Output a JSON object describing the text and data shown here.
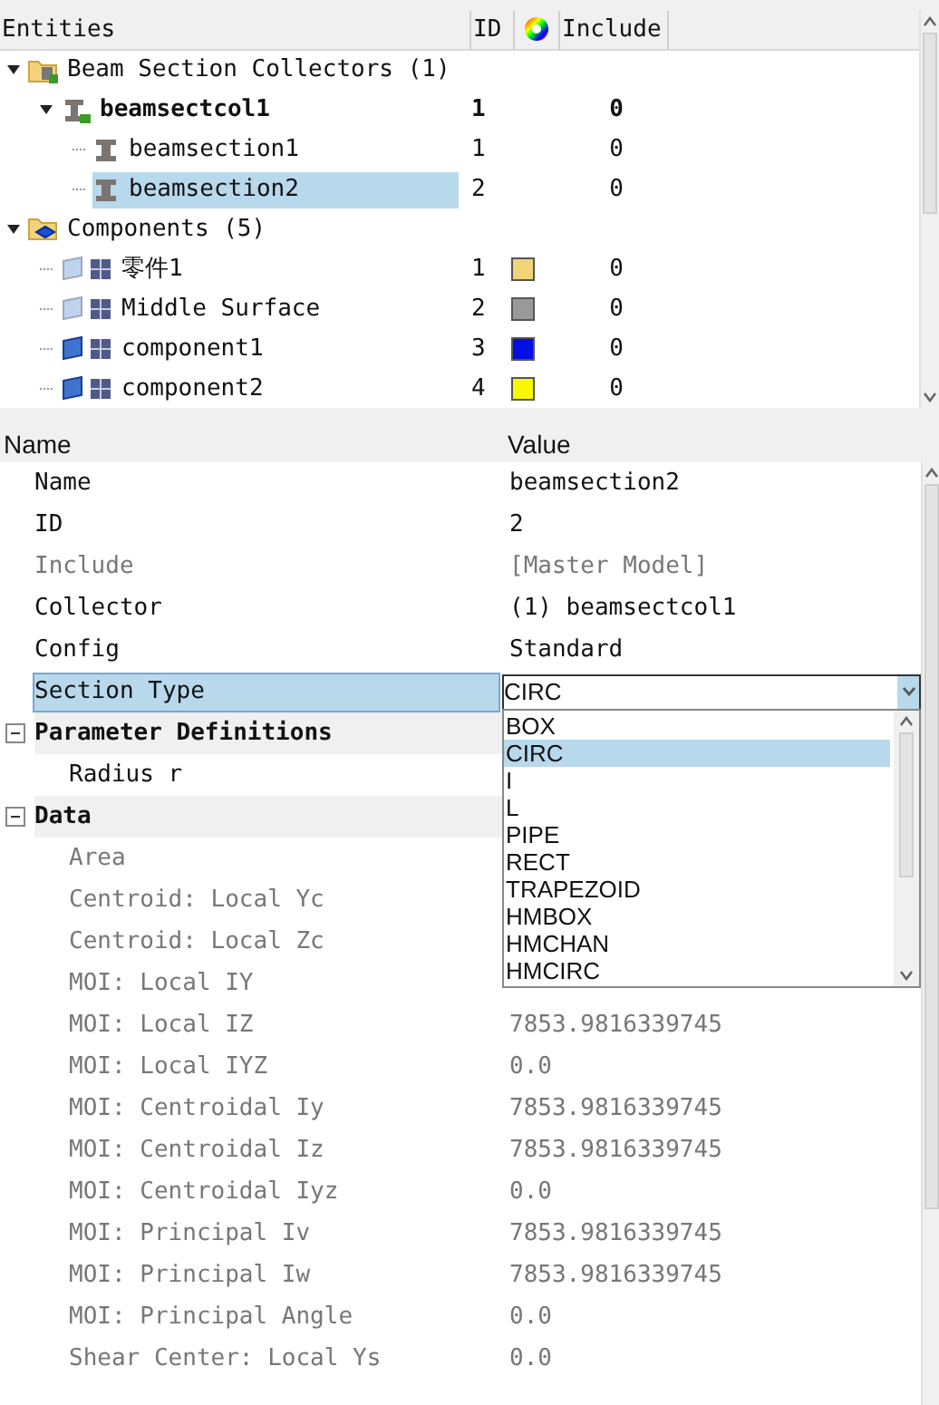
{
  "tree": {
    "columns": [
      "Entities",
      "ID",
      "Include"
    ],
    "nodes": [
      {
        "kind": "beam_folder",
        "label": "Beam Section Collectors (1)",
        "expanded": true,
        "children": [
          {
            "kind": "beam_collector",
            "label": "beamsectcol1",
            "id": "1",
            "include": "0",
            "bold": true,
            "expanded": true,
            "selected": false,
            "children": [
              {
                "kind": "beam_section",
                "label": "beamsection1",
                "id": "1",
                "include": "0",
                "selected": false
              },
              {
                "kind": "beam_section",
                "label": "beamsection2",
                "id": "2",
                "include": "0",
                "selected": true
              }
            ]
          }
        ]
      },
      {
        "kind": "component_folder",
        "label": "Components (5)",
        "expanded": true,
        "children": [
          {
            "kind": "component_hidden",
            "label": "零件1",
            "id": "1",
            "include": "0",
            "color": "#f0d478",
            "selected": false
          },
          {
            "kind": "component_hidden",
            "label": "Middle Surface",
            "id": "2",
            "include": "0",
            "color": "#9a9a9a",
            "selected": false
          },
          {
            "kind": "component",
            "label": "component1",
            "id": "3",
            "include": "0",
            "color": "#0010e0",
            "selected": false
          },
          {
            "kind": "component",
            "label": "component2",
            "id": "4",
            "include": "0",
            "color": "#f8f800",
            "selected": false
          }
        ]
      }
    ]
  },
  "properties": {
    "columns": [
      "Name",
      "Value"
    ],
    "rows": [
      {
        "kind": "row",
        "name": "Name",
        "value": "beamsection2",
        "disabled": false,
        "selected": false
      },
      {
        "kind": "row",
        "name": "ID",
        "value": "2",
        "disabled": false,
        "selected": false
      },
      {
        "kind": "row",
        "name": "Include",
        "value": "[Master Model]",
        "disabled": true,
        "selected": false
      },
      {
        "kind": "row",
        "name": "Collector",
        "value": "(1) beamsectcol1",
        "disabled": false,
        "selected": false
      },
      {
        "kind": "row",
        "name": "Config",
        "value": "Standard",
        "disabled": false,
        "selected": false
      },
      {
        "kind": "combo",
        "name": "Section Type",
        "value": "CIRC",
        "disabled": false,
        "selected": true,
        "options": [
          {
            "label": "BOX",
            "selected": false
          },
          {
            "label": "CIRC",
            "selected": true
          },
          {
            "label": "I",
            "selected": false
          },
          {
            "label": "L",
            "selected": false
          },
          {
            "label": "PIPE",
            "selected": false
          },
          {
            "label": "RECT",
            "selected": false
          },
          {
            "label": "TRAPEZOID",
            "selected": false
          },
          {
            "label": "HMBOX",
            "selected": false
          },
          {
            "label": "HMCHAN",
            "selected": false
          },
          {
            "label": "HMCIRC",
            "selected": false
          }
        ]
      },
      {
        "kind": "group",
        "name": "Parameter Definitions",
        "expanded": true
      },
      {
        "kind": "subrow",
        "name": "Radius r",
        "disabled": false,
        "selected": false
      },
      {
        "kind": "group",
        "name": "Data",
        "expanded": true
      },
      {
        "kind": "subrow",
        "name": "Area",
        "disabled": true,
        "selected": false
      },
      {
        "kind": "subrow",
        "name": "Centroid: Local Yc",
        "disabled": true,
        "selected": false
      },
      {
        "kind": "subrow",
        "name": "Centroid: Local Zc",
        "disabled": true,
        "selected": false
      },
      {
        "kind": "subrow",
        "name": "MOI: Local IY",
        "disabled": true,
        "selected": false
      },
      {
        "kind": "subrow",
        "name": "MOI: Local IZ",
        "value": "7853.9816339745",
        "disabled": true,
        "selected": false
      },
      {
        "kind": "subrow",
        "name": "MOI: Local IYZ",
        "value": "0.0",
        "disabled": true,
        "selected": false
      },
      {
        "kind": "subrow",
        "name": "MOI: Centroidal Iy",
        "value": "7853.9816339745",
        "disabled": true,
        "selected": false
      },
      {
        "kind": "subrow",
        "name": "MOI: Centroidal Iz",
        "value": "7853.9816339745",
        "disabled": true,
        "selected": false
      },
      {
        "kind": "subrow",
        "name": "MOI: Centroidal Iyz",
        "value": "0.0",
        "disabled": true,
        "selected": false
      },
      {
        "kind": "subrow",
        "name": "MOI: Principal Iv",
        "value": "7853.9816339745",
        "disabled": true,
        "selected": false
      },
      {
        "kind": "subrow",
        "name": "MOI: Principal Iw",
        "value": "7853.9816339745",
        "disabled": true,
        "selected": false
      },
      {
        "kind": "subrow",
        "name": "MOI: Principal Angle",
        "value": "0.0",
        "disabled": true,
        "selected": false
      },
      {
        "kind": "subrow",
        "name": "Shear Center: Local Ys",
        "value": "0.0",
        "disabled": true,
        "selected": false
      }
    ]
  }
}
